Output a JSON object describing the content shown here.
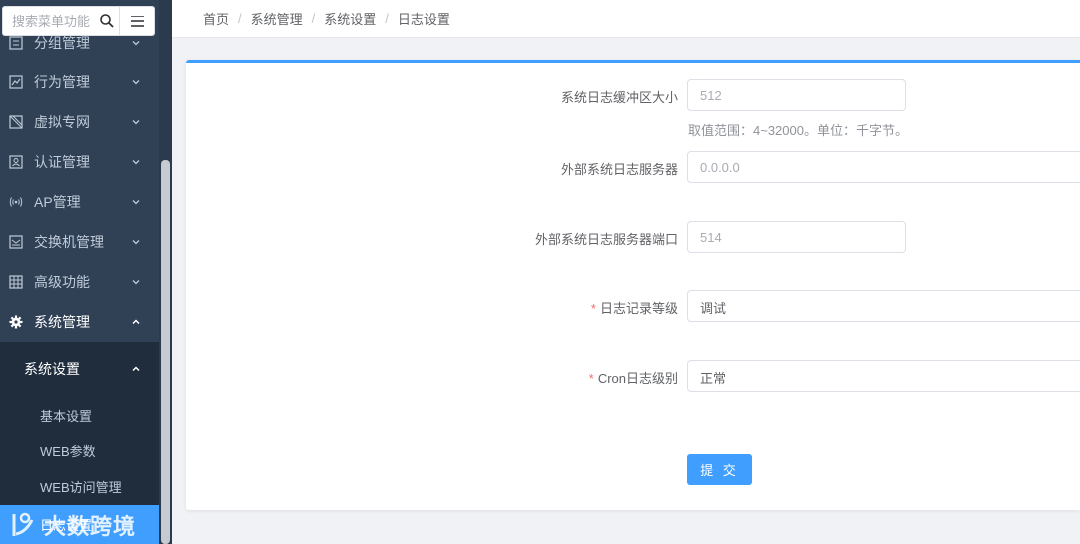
{
  "search": {
    "placeholder": "搜索菜单功能"
  },
  "sidebar": {
    "items": [
      {
        "label": "分组管理",
        "icon": "group-icon"
      },
      {
        "label": "行为管理",
        "icon": "behavior-icon"
      },
      {
        "label": "虚拟专网",
        "icon": "vpn-icon"
      },
      {
        "label": "认证管理",
        "icon": "auth-icon"
      },
      {
        "label": "AP管理",
        "icon": "wireless-icon"
      },
      {
        "label": "交换机管理",
        "icon": "switch-icon"
      },
      {
        "label": "高级功能",
        "icon": "grid-icon"
      },
      {
        "label": "系统管理",
        "icon": "gear-icon"
      }
    ],
    "submenu_title": "系统设置",
    "sub_items": [
      "基本设置",
      "WEB参数",
      "WEB访问管理",
      "日志设置"
    ]
  },
  "breadcrumb": [
    "首页",
    "系统管理",
    "系统设置",
    "日志设置"
  ],
  "form": {
    "buffer": {
      "label": "系统日志缓冲区大小",
      "placeholder": "512",
      "hint": "取值范围：4~32000。单位：千字节。"
    },
    "server": {
      "label": "外部系统日志服务器",
      "placeholder": "0.0.0.0"
    },
    "port": {
      "label": "外部系统日志服务器端口",
      "placeholder": "514"
    },
    "level": {
      "required": "*",
      "label": "日志记录等级",
      "value": "调试"
    },
    "cron": {
      "required": "*",
      "label": "Cron日志级别",
      "value": "正常"
    },
    "submit_label": "提 交"
  },
  "watermark": "大数跨境",
  "colors": {
    "primary": "#409eff",
    "sidebar_bg": "#304156",
    "submenu_bg": "#1f2d3d",
    "required": "#f56c6c"
  }
}
